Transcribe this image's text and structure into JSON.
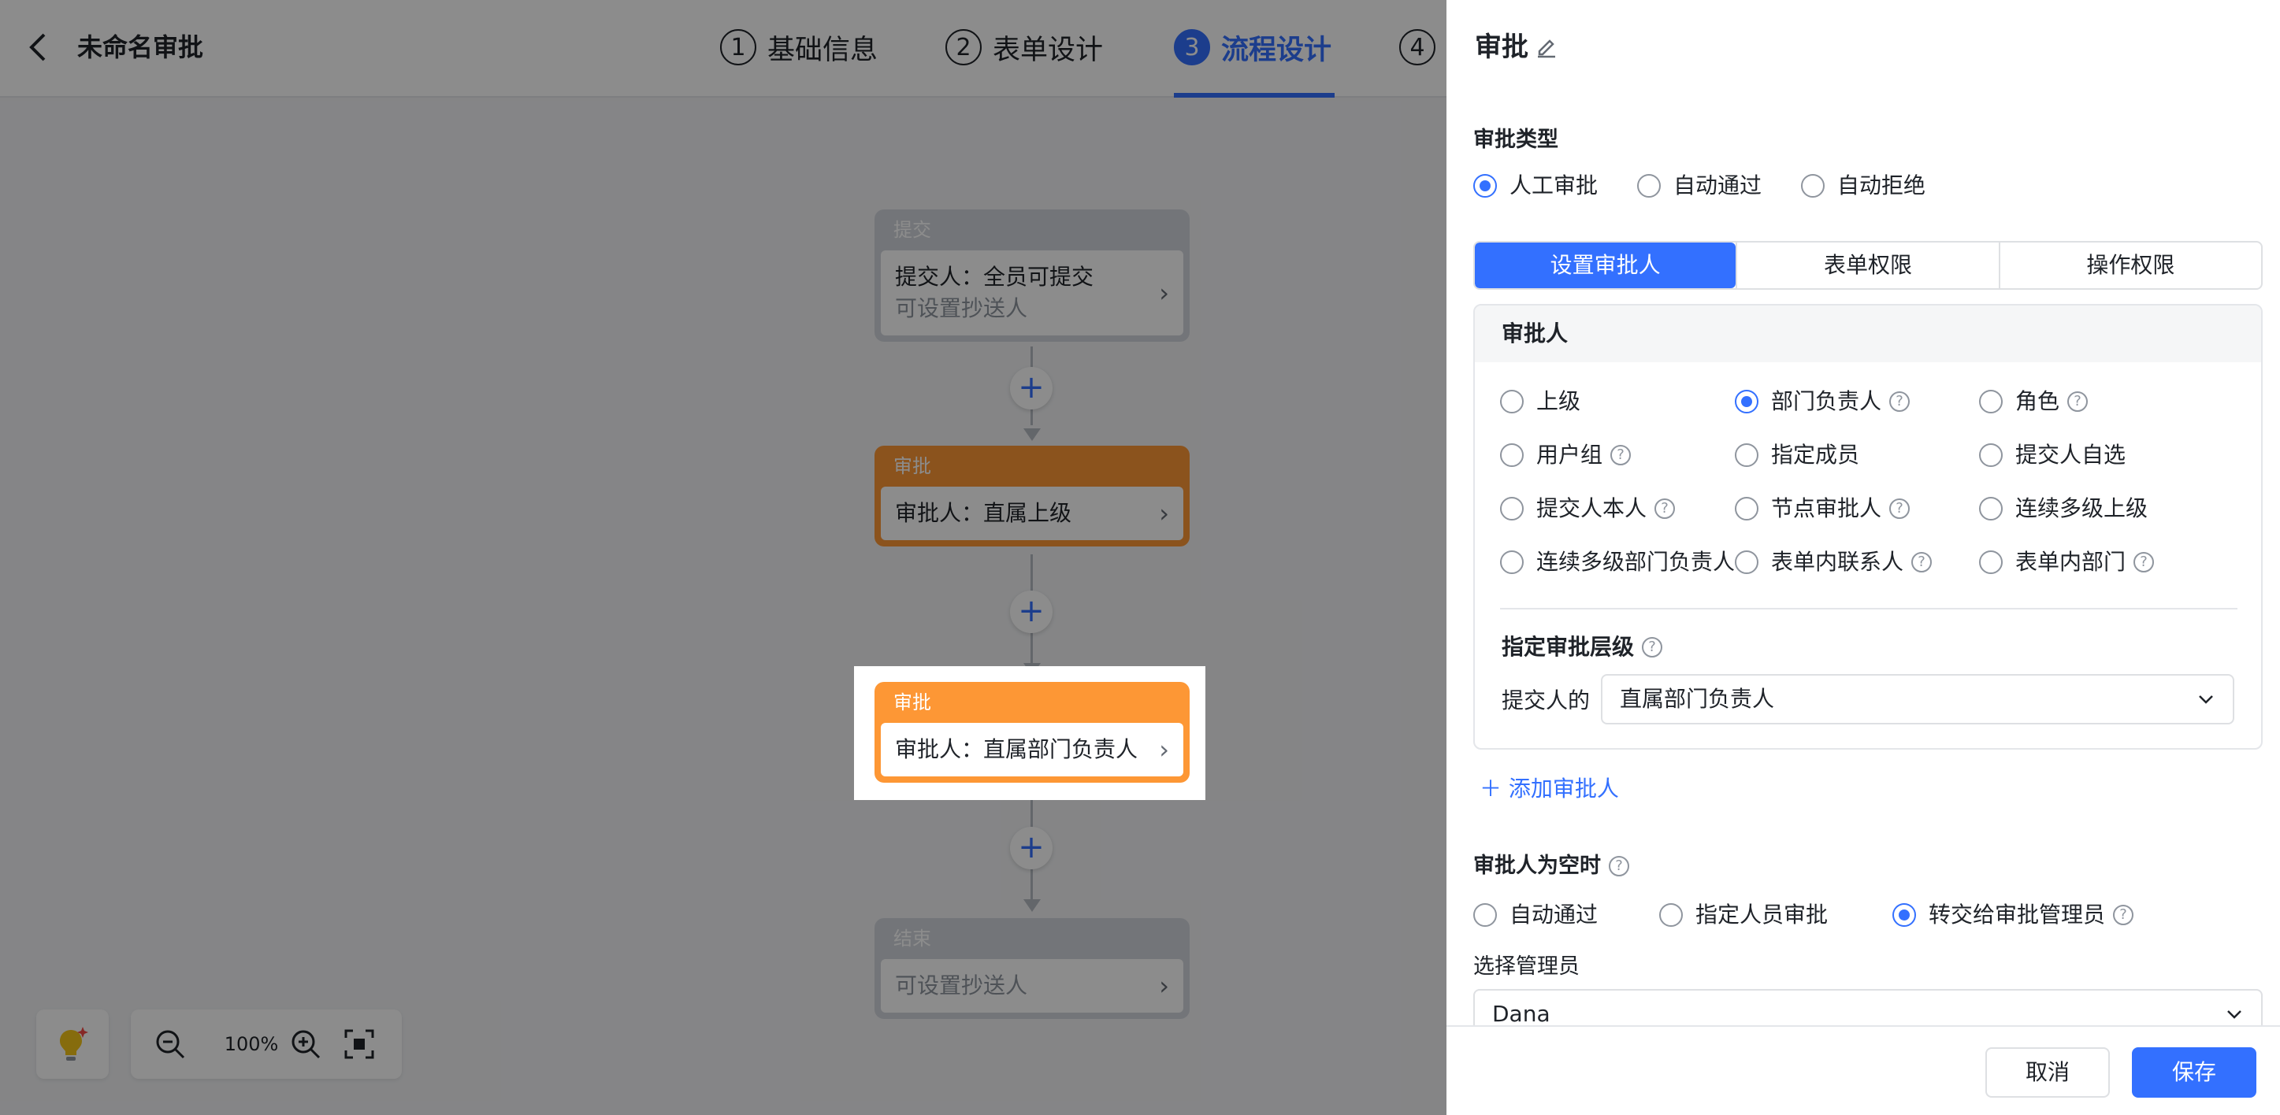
{
  "app": {
    "title": "未命名审批"
  },
  "steps": [
    {
      "num": "1",
      "label": "基础信息"
    },
    {
      "num": "2",
      "label": "表单设计"
    },
    {
      "num": "3",
      "label": "流程设计"
    },
    {
      "num": "4",
      "label": ""
    }
  ],
  "flow": {
    "submit": {
      "title": "提交",
      "line1": "提交人：全员可提交",
      "line2": "可设置抄送人"
    },
    "approval1": {
      "title": "审批",
      "line1": "审批人：直属上级"
    },
    "approval2": {
      "title": "审批",
      "line1": "审批人：直属部门负责人"
    },
    "end": {
      "title": "结束",
      "line1": "可设置抄送人"
    }
  },
  "zoom": {
    "value": "100%"
  },
  "colors": {
    "accent": "#3370ff",
    "node_orange": "#fd9735",
    "node_gray": "#d2d6dc"
  },
  "panel": {
    "title": "审批",
    "approval_type": {
      "label": "审批类型",
      "options": [
        "人工审批",
        "自动通过",
        "自动拒绝"
      ],
      "selected": 0
    },
    "tabs": [
      "设置审批人",
      "表单权限",
      "操作权限"
    ],
    "approver": {
      "header": "审批人",
      "options": [
        {
          "label": "上级"
        },
        {
          "label": "部门负责人"
        },
        {
          "label": "角色"
        },
        {
          "label": "用户组"
        },
        {
          "label": "指定成员"
        },
        {
          "label": "提交人自选"
        },
        {
          "label": "提交人本人"
        },
        {
          "label": "节点审批人"
        },
        {
          "label": "连续多级上级"
        },
        {
          "label": "连续多级部门负责人"
        },
        {
          "label": "表单内联系人"
        },
        {
          "label": "表单内部门"
        }
      ],
      "selected": 1,
      "level": {
        "label": "指定审批层级",
        "prefix": "提交人的",
        "value": "直属部门负责人"
      },
      "add_label": "添加审批人"
    },
    "empty": {
      "label": "审批人为空时",
      "options": [
        "自动通过",
        "指定人员审批",
        "转交给审批管理员"
      ],
      "selected": 2
    },
    "manager": {
      "label": "选择管理员",
      "value": "Dana"
    },
    "cancel": "取消",
    "save": "保存"
  }
}
